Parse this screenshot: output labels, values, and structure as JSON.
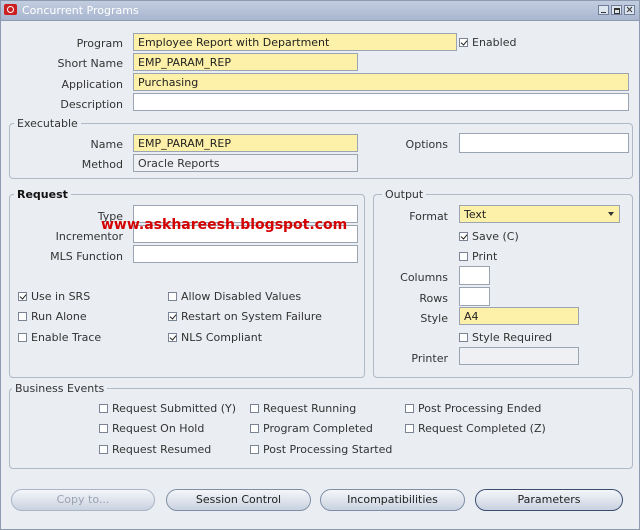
{
  "window": {
    "title": "Concurrent Programs"
  },
  "header": {
    "program_label": "Program",
    "program_value": "Employee Report with Department",
    "enabled_label": "Enabled",
    "short_name_label": "Short Name",
    "short_name_value": "EMP_PARAM_REP",
    "application_label": "Application",
    "application_value": "Purchasing",
    "description_label": "Description",
    "description_value": ""
  },
  "executable": {
    "title": "Executable",
    "name_label": "Name",
    "name_value": "EMP_PARAM_REP",
    "method_label": "Method",
    "method_value": "Oracle Reports",
    "options_label": "Options",
    "options_value": ""
  },
  "request": {
    "title": "Request",
    "type_label": "Type",
    "type_value": "",
    "incrementor_label": "Incrementor",
    "incrementor_value": "",
    "mls_label": "MLS Function",
    "mls_value": "",
    "use_in_srs": "Use in SRS",
    "run_alone": "Run Alone",
    "enable_trace": "Enable Trace",
    "allow_disabled": "Allow Disabled Values",
    "restart_on_failure": "Restart on System Failure",
    "nls_compliant": "NLS Compliant"
  },
  "output": {
    "title": "Output",
    "format_label": "Format",
    "format_value": "Text",
    "save_label": "Save (C)",
    "print_label": "Print",
    "columns_label": "Columns",
    "columns_value": "",
    "rows_label": "Rows",
    "rows_value": "",
    "style_label": "Style",
    "style_value": "A4",
    "style_required": "Style Required",
    "printer_label": "Printer",
    "printer_value": ""
  },
  "business_events": {
    "title": "Business Events",
    "submitted": "Request Submitted (Y)",
    "on_hold": "Request On Hold",
    "resumed": "Request Resumed",
    "running": "Request Running",
    "program_completed": "Program Completed",
    "post_processing_started": "Post Processing Started",
    "post_processing_ended": "Post Processing Ended",
    "request_completed": "Request Completed (Z)"
  },
  "buttons": {
    "copy_to": "Copy to...",
    "session_control": "Session Control",
    "incompatibilities": "Incompatibilities",
    "parameters": "Parameters"
  },
  "watermark": "www.askhareesh.blogspot.com"
}
